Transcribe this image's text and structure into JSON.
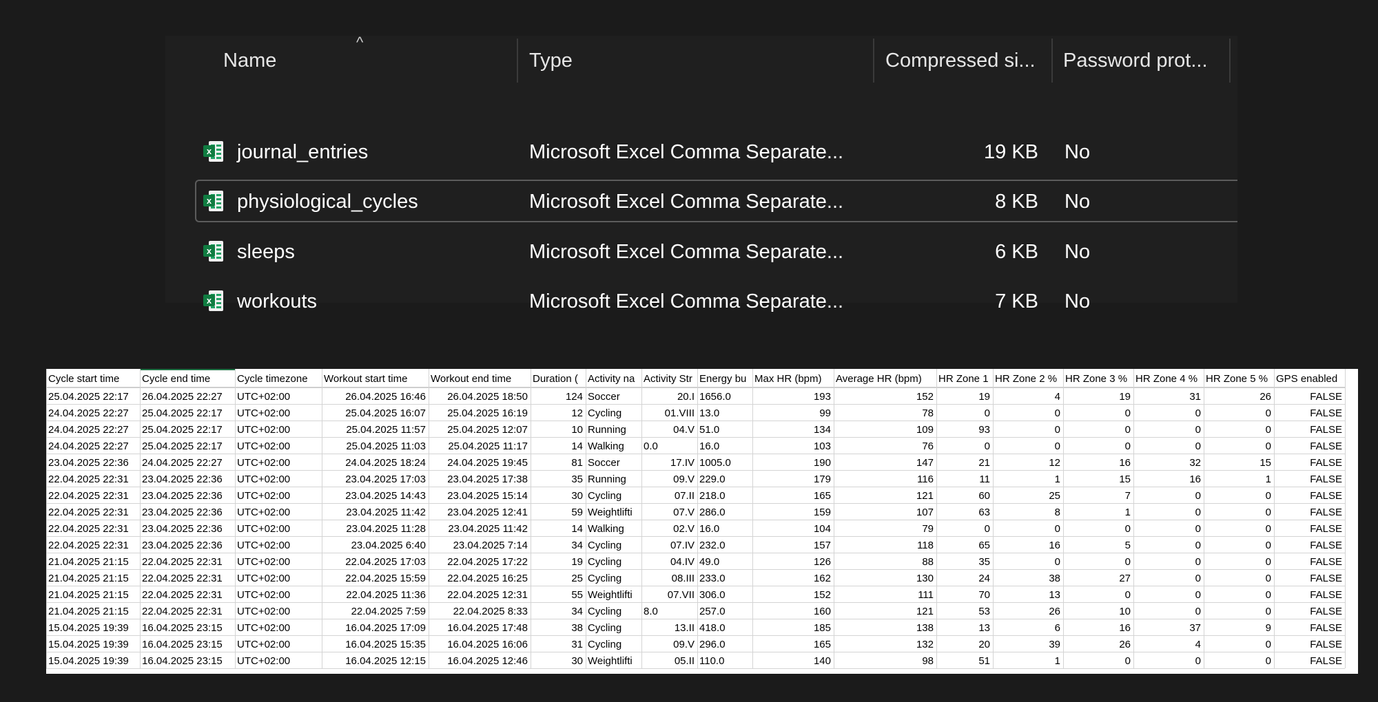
{
  "explorer": {
    "columns": {
      "name": "Name",
      "type": "Type",
      "compressed_size": "Compressed si...",
      "password_protected": "Password prot..."
    },
    "sort_indicator": "^",
    "files": [
      {
        "name": "journal_entries",
        "type": "Microsoft Excel Comma Separate...",
        "size": "19 KB",
        "password": "No",
        "icon": "excel-csv-icon"
      },
      {
        "name": "physiological_cycles",
        "type": "Microsoft Excel Comma Separate...",
        "size": "8 KB",
        "password": "No",
        "icon": "excel-csv-icon",
        "selected": true
      },
      {
        "name": "sleeps",
        "type": "Microsoft Excel Comma Separate...",
        "size": "6 KB",
        "password": "No",
        "icon": "excel-csv-icon"
      },
      {
        "name": "workouts",
        "type": "Microsoft Excel Comma Separate...",
        "size": "7 KB",
        "password": "No",
        "icon": "excel-csv-icon"
      }
    ]
  },
  "sheet": {
    "headers": [
      "Cycle start time",
      "Cycle end time",
      "Cycle timezone",
      "Workout start time",
      "Workout end time",
      "Duration (",
      "Activity na",
      "Activity Str",
      "Energy bu",
      "Max HR (bpm)",
      "Average HR (bpm)",
      "HR Zone 1",
      "HR Zone 2 %",
      "HR Zone 3 %",
      "HR Zone 4 %",
      "HR Zone 5 %",
      "GPS enabled"
    ],
    "rows": [
      [
        "25.04.2025 22:17",
        "26.04.2025 22:27",
        "UTC+02:00",
        "26.04.2025 16:46",
        "26.04.2025 18:50",
        "124",
        "Soccer",
        "20.I",
        "1656.0",
        "193",
        "152",
        "19",
        "4",
        "19",
        "31",
        "26",
        "FALSE"
      ],
      [
        "24.04.2025 22:27",
        "25.04.2025 22:17",
        "UTC+02:00",
        "25.04.2025 16:07",
        "25.04.2025 16:19",
        "12",
        "Cycling",
        "01.VIII",
        "13.0",
        "99",
        "78",
        "0",
        "0",
        "0",
        "0",
        "0",
        "FALSE"
      ],
      [
        "24.04.2025 22:27",
        "25.04.2025 22:17",
        "UTC+02:00",
        "25.04.2025 11:57",
        "25.04.2025 12:07",
        "10",
        "Running",
        "04.V",
        "51.0",
        "134",
        "109",
        "93",
        "0",
        "0",
        "0",
        "0",
        "FALSE"
      ],
      [
        "24.04.2025 22:27",
        "25.04.2025 22:17",
        "UTC+02:00",
        "25.04.2025 11:03",
        "25.04.2025 11:17",
        "14",
        "Walking",
        "0.0",
        "16.0",
        "103",
        "76",
        "0",
        "0",
        "0",
        "0",
        "0",
        "FALSE"
      ],
      [
        "23.04.2025 22:36",
        "24.04.2025 22:27",
        "UTC+02:00",
        "24.04.2025 18:24",
        "24.04.2025 19:45",
        "81",
        "Soccer",
        "17.IV",
        "1005.0",
        "190",
        "147",
        "21",
        "12",
        "16",
        "32",
        "15",
        "FALSE"
      ],
      [
        "22.04.2025 22:31",
        "23.04.2025 22:36",
        "UTC+02:00",
        "23.04.2025 17:03",
        "23.04.2025 17:38",
        "35",
        "Running",
        "09.V",
        "229.0",
        "179",
        "116",
        "11",
        "1",
        "15",
        "16",
        "1",
        "FALSE"
      ],
      [
        "22.04.2025 22:31",
        "23.04.2025 22:36",
        "UTC+02:00",
        "23.04.2025 14:43",
        "23.04.2025 15:14",
        "30",
        "Cycling",
        "07.II",
        "218.0",
        "165",
        "121",
        "60",
        "25",
        "7",
        "0",
        "0",
        "FALSE"
      ],
      [
        "22.04.2025 22:31",
        "23.04.2025 22:36",
        "UTC+02:00",
        "23.04.2025 11:42",
        "23.04.2025 12:41",
        "59",
        "Weightlifti",
        "07.V",
        "286.0",
        "159",
        "107",
        "63",
        "8",
        "1",
        "0",
        "0",
        "FALSE"
      ],
      [
        "22.04.2025 22:31",
        "23.04.2025 22:36",
        "UTC+02:00",
        "23.04.2025 11:28",
        "23.04.2025 11:42",
        "14",
        "Walking",
        "02.V",
        "16.0",
        "104",
        "79",
        "0",
        "0",
        "0",
        "0",
        "0",
        "FALSE"
      ],
      [
        "22.04.2025 22:31",
        "23.04.2025 22:36",
        "UTC+02:00",
        "23.04.2025 6:40",
        "23.04.2025 7:14",
        "34",
        "Cycling",
        "07.IV",
        "232.0",
        "157",
        "118",
        "65",
        "16",
        "5",
        "0",
        "0",
        "FALSE"
      ],
      [
        "21.04.2025 21:15",
        "22.04.2025 22:31",
        "UTC+02:00",
        "22.04.2025 17:03",
        "22.04.2025 17:22",
        "19",
        "Cycling",
        "04.IV",
        "49.0",
        "126",
        "88",
        "35",
        "0",
        "0",
        "0",
        "0",
        "FALSE"
      ],
      [
        "21.04.2025 21:15",
        "22.04.2025 22:31",
        "UTC+02:00",
        "22.04.2025 15:59",
        "22.04.2025 16:25",
        "25",
        "Cycling",
        "08.III",
        "233.0",
        "162",
        "130",
        "24",
        "38",
        "27",
        "0",
        "0",
        "FALSE"
      ],
      [
        "21.04.2025 21:15",
        "22.04.2025 22:31",
        "UTC+02:00",
        "22.04.2025 11:36",
        "22.04.2025 12:31",
        "55",
        "Weightlifti",
        "07.VII",
        "306.0",
        "152",
        "111",
        "70",
        "13",
        "0",
        "0",
        "0",
        "FALSE"
      ],
      [
        "21.04.2025 21:15",
        "22.04.2025 22:31",
        "UTC+02:00",
        "22.04.2025 7:59",
        "22.04.2025 8:33",
        "34",
        "Cycling",
        "8.0",
        "257.0",
        "160",
        "121",
        "53",
        "26",
        "10",
        "0",
        "0",
        "FALSE"
      ],
      [
        "15.04.2025 19:39",
        "16.04.2025 23:15",
        "UTC+02:00",
        "16.04.2025 17:09",
        "16.04.2025 17:48",
        "38",
        "Cycling",
        "13.II",
        "418.0",
        "185",
        "138",
        "13",
        "6",
        "16",
        "37",
        "9",
        "FALSE"
      ],
      [
        "15.04.2025 19:39",
        "16.04.2025 23:15",
        "UTC+02:00",
        "16.04.2025 15:35",
        "16.04.2025 16:06",
        "31",
        "Cycling",
        "09.V",
        "296.0",
        "165",
        "132",
        "20",
        "39",
        "26",
        "4",
        "0",
        "FALSE"
      ],
      [
        "15.04.2025 19:39",
        "16.04.2025 23:15",
        "UTC+02:00",
        "16.04.2025 12:15",
        "16.04.2025 12:46",
        "30",
        "Weightlifti",
        "05.II",
        "110.0",
        "140",
        "98",
        "51",
        "1",
        "0",
        "0",
        "0",
        "FALSE"
      ]
    ]
  }
}
